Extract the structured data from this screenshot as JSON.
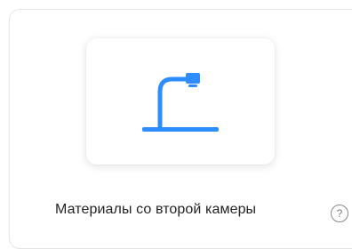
{
  "option": {
    "label": "Материалы со второй камеры",
    "icon": "document-camera-icon",
    "help_glyph": "?",
    "help_icon": "help-circle-icon"
  },
  "colors": {
    "accent": "#2d8cff",
    "text": "#232323",
    "muted": "#7a7a7a"
  }
}
